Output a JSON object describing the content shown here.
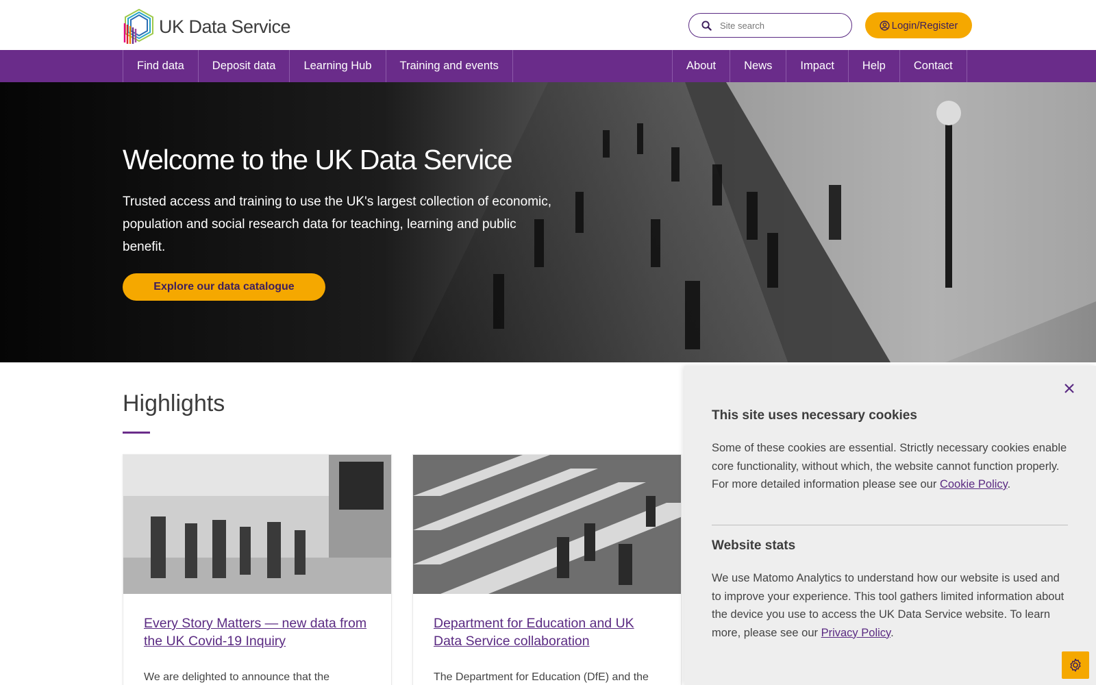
{
  "header": {
    "logo_text": "UK Data Service",
    "search": {
      "placeholder": "Site search",
      "value": ""
    },
    "login_label": "Login/Register"
  },
  "nav": {
    "left": [
      "Find data",
      "Deposit data",
      "Learning Hub",
      "Training and events"
    ],
    "right": [
      "About",
      "News",
      "Impact",
      "Help",
      "Contact"
    ]
  },
  "hero": {
    "title": "Welcome to the UK Data Service",
    "text": "Trusted access and training to use the UK's largest collection of economic, population and social research data for teaching, learning and public benefit.",
    "button_label": "Explore our data catalogue"
  },
  "highlights": {
    "title": "Highlights",
    "cards": [
      {
        "title": "Every Story Matters — new data from the UK Covid-19 Inquiry",
        "text": "We are delighted to announce that the"
      },
      {
        "title": "Department for Education and UK Data Service collaboration",
        "text": "The Department for Education (DfE) and the"
      }
    ]
  },
  "cookie": {
    "heading1": "This site uses necessary cookies",
    "text1": "Some of these cookies are essential. Strictly necessary cookies enable core functionality, without which, the website cannot function properly. For more detailed information please see our ",
    "link1": "Cookie Policy",
    "heading2": "Website stats",
    "text2": "We use Matomo Analytics to understand how our website is used and to improve your experience. This tool gathers limited information about the device you use to access the UK Data Service website. To learn more, please see our ",
    "link2": "Privacy Policy",
    "period": "."
  },
  "colors": {
    "purple": "#6a2c8a",
    "amber": "#f5a800",
    "text_dark": "#3c3c3c"
  },
  "icons": [
    "search-icon",
    "user-circle-icon",
    "close-icon",
    "gear-icon"
  ]
}
